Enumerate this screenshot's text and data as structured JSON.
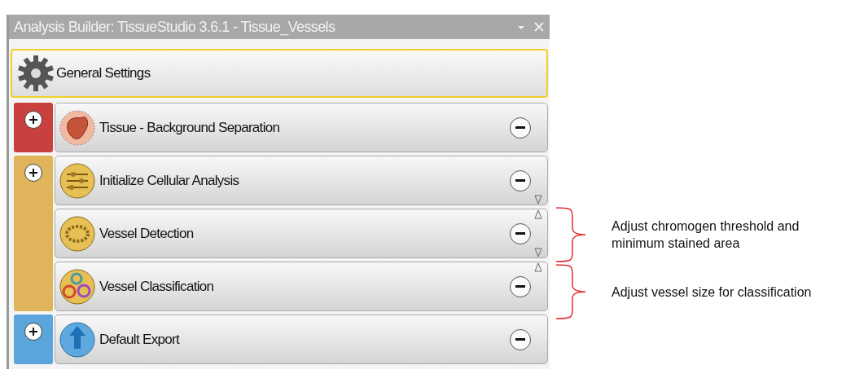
{
  "window": {
    "title": "Analysis Builder: TissueStudio 3.6.1 - Tissue_Vessels"
  },
  "general_settings": {
    "label": "General Settings",
    "selected": true
  },
  "groups": [
    {
      "color": "#c8413f",
      "expanded": true,
      "steps": [
        {
          "label": "Tissue - Background Separation",
          "kind": "tissue",
          "move_up": false,
          "move_down": false
        }
      ]
    },
    {
      "color": "#e0b45a",
      "expanded": true,
      "steps": [
        {
          "label": "Initialize Cellular Analysis",
          "kind": "sliders",
          "move_up": false,
          "move_down": true
        },
        {
          "label": "Vessel Detection",
          "kind": "ring",
          "move_up": true,
          "move_down": true
        },
        {
          "label": "Vessel Classification",
          "kind": "rings",
          "move_up": true,
          "move_down": false
        }
      ]
    },
    {
      "color": "#5aa6dc",
      "expanded": true,
      "steps": [
        {
          "label": "Default Export",
          "kind": "export",
          "move_up": false,
          "move_down": false
        }
      ]
    }
  ],
  "annotations": [
    {
      "text": "Adjust chromogen threshold and minimum stained area"
    },
    {
      "text": "Adjust vessel size for classification"
    }
  ]
}
